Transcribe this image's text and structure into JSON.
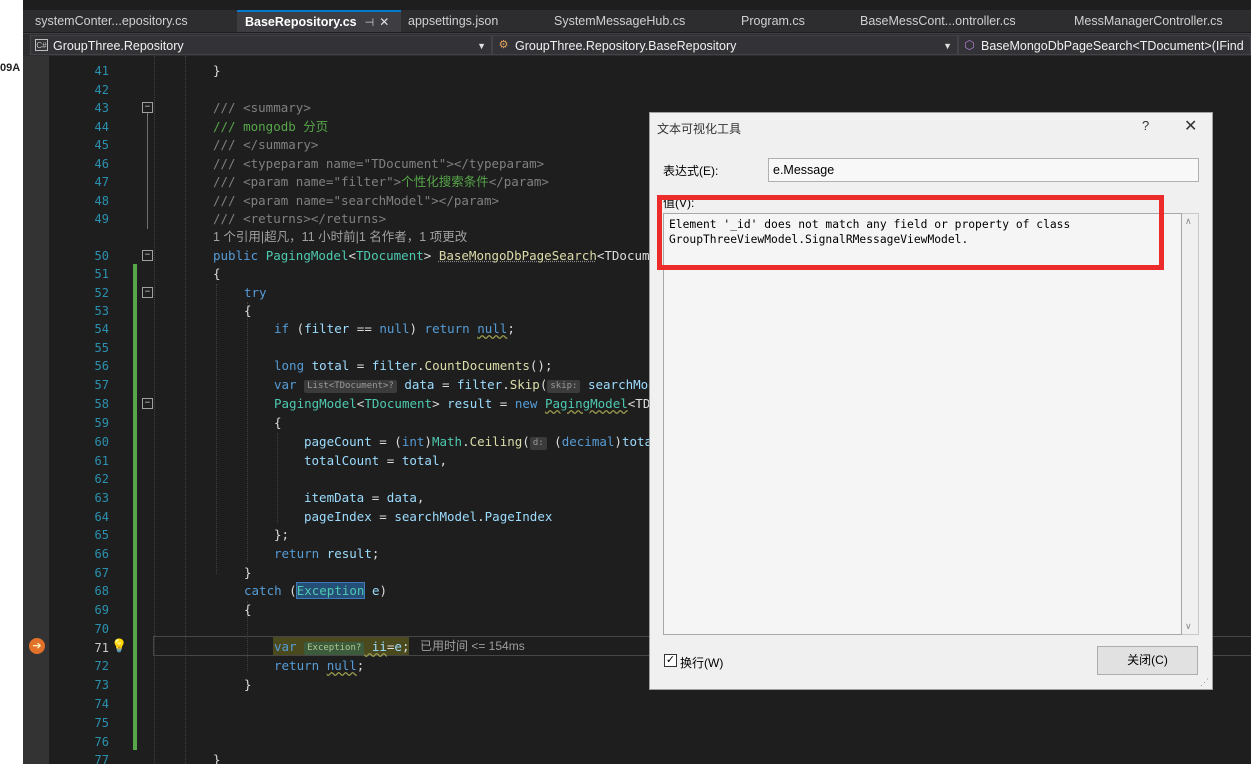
{
  "left_strip": {
    "text": "09A"
  },
  "tabs": [
    {
      "label": "systemConter...epository.cs"
    },
    {
      "label": "BaseRepository.cs",
      "pin": "⊣",
      "close": "✕"
    },
    {
      "label": "appsettings.json"
    },
    {
      "label": "SystemMessageHub.cs"
    },
    {
      "label": "Program.cs"
    },
    {
      "label": "BaseMessCont...ontroller.cs"
    },
    {
      "label": "MessManagerController.cs"
    }
  ],
  "navbar": {
    "project": "GroupThree.Repository",
    "class": "GroupThree.Repository.BaseRepository",
    "member": "BaseMongoDbPageSearch<TDocument>(IFind"
  },
  "line_numbers": [
    "41",
    "42",
    "43",
    "44",
    "45",
    "46",
    "47",
    "48",
    "49",
    "50",
    "51",
    "52",
    "53",
    "54",
    "55",
    "56",
    "57",
    "58",
    "59",
    "60",
    "61",
    "62",
    "63",
    "64",
    "65",
    "66",
    "67",
    "68",
    "69",
    "70",
    "71",
    "72",
    "73",
    "74",
    "75",
    "76",
    "77"
  ],
  "code": {
    "l41": "}",
    "l43_a": "/// ",
    "l43_b": "<summary>",
    "l44": "/// mongodb 分页",
    "l45_a": "/// ",
    "l45_b": "</summary>",
    "l46_a": "/// ",
    "l46_b": "<typeparam ",
    "l46_c": "name=",
    "l46_d": "\"TDocument\"",
    "l46_e": "></typeparam>",
    "l47_a": "/// ",
    "l47_b": "<param ",
    "l47_c": "name=",
    "l47_d": "\"filter\"",
    "l47_e": ">",
    "l47_f": "个性化搜索条件",
    "l47_g": "</param>",
    "l48_a": "/// ",
    "l48_b": "<param ",
    "l48_c": "name=",
    "l48_d": "\"searchModel\"",
    "l48_e": "></param>",
    "l49_a": "/// ",
    "l49_b": "<returns></returns>",
    "codelens": "1 个引用|超凡，11 小时前|1 名作者，1 项更改",
    "l50_a": "public ",
    "l50_b": "PagingModel",
    "l50_c": "<",
    "l50_d": "TDocument",
    "l50_e": "> ",
    "l50_f": "BaseMongoDbPageSearch",
    "l50_g": "<TDocum",
    "l51": "{",
    "l52": "try",
    "l53": "{",
    "l54_a": "if ",
    "l54_b": "(",
    "l54_c": "filter",
    "l54_d": " == ",
    "l54_e": "null",
    "l54_f": ") ",
    "l54_g": "return ",
    "l54_h": "null",
    "l54_i": ";",
    "l56_a": "long ",
    "l56_b": "total",
    "l56_c": " = ",
    "l56_d": "filter",
    "l56_e": ".",
    "l56_f": "CountDocuments",
    "l56_g": "();",
    "l57_a": "var ",
    "l57_hint": "List<TDocument>?",
    "l57_b": " data",
    "l57_c": " = ",
    "l57_d": "filter",
    "l57_e": ".",
    "l57_f": "Skip",
    "l57_g": "(",
    "l57_hint2": "skip:",
    "l57_h": " searchMod",
    "l58_a": "PagingModel",
    "l58_b": "<",
    "l58_c": "TDocument",
    "l58_d": "> ",
    "l58_e": "result",
    "l58_f": " = ",
    "l58_g": "new ",
    "l58_h": "PagingModel",
    "l58_i": "<TD",
    "l59": "{",
    "l60_a": "pageCount",
    "l60_b": " = (",
    "l60_c": "int",
    "l60_d": ")",
    "l60_e": "Math",
    "l60_f": ".",
    "l60_g": "Ceiling",
    "l60_h": "(",
    "l60_hint": "d:",
    "l60_i": " (",
    "l60_j": "decimal",
    "l60_k": ")",
    "l60_l": "tota",
    "l61_a": "totalCount",
    "l61_b": " = ",
    "l61_c": "total",
    "l61_d": ",",
    "l63_a": "itemData",
    "l63_b": " = ",
    "l63_c": "data",
    "l63_d": ",",
    "l64_a": "pageIndex",
    "l64_b": " = ",
    "l64_c": "searchModel",
    "l64_d": ".",
    "l64_e": "PageIndex",
    "l65": "};",
    "l66_a": "return ",
    "l66_b": "result",
    "l66_c": ";",
    "l67": "}",
    "l68_a": "catch ",
    "l68_b": "(",
    "l68_c": "Exception",
    "l68_d": " ",
    "l68_e": "e",
    "l68_f": ")",
    "l69": "{",
    "l71_a": "var ",
    "l71_hint": "Exception?",
    "l71_b": " ii",
    "l71_c": "=",
    "l71_d": "e",
    "l71_e": ";",
    "l72_a": "return ",
    "l72_b": "null",
    "l72_c": ";",
    "l73": "}",
    "l77": "}"
  },
  "elapsed": "已用时间 <= 154ms",
  "dialog": {
    "title": "文本可视化工具",
    "help": "?",
    "close": "✕",
    "expression_label": "表达式(E):",
    "expression_value": "e.Message",
    "value_label": "值(V):",
    "value_text": "Element '_id' does not match any field or property of class\nGroupThreeViewModel.SignalRMessageViewModel.",
    "wrap_label": "换行(W)",
    "close_button": "关闭(C)"
  },
  "colors": {
    "highlight_box": "#ec2b2b",
    "change_bar": "#57a64a",
    "accent": "#007acc"
  }
}
